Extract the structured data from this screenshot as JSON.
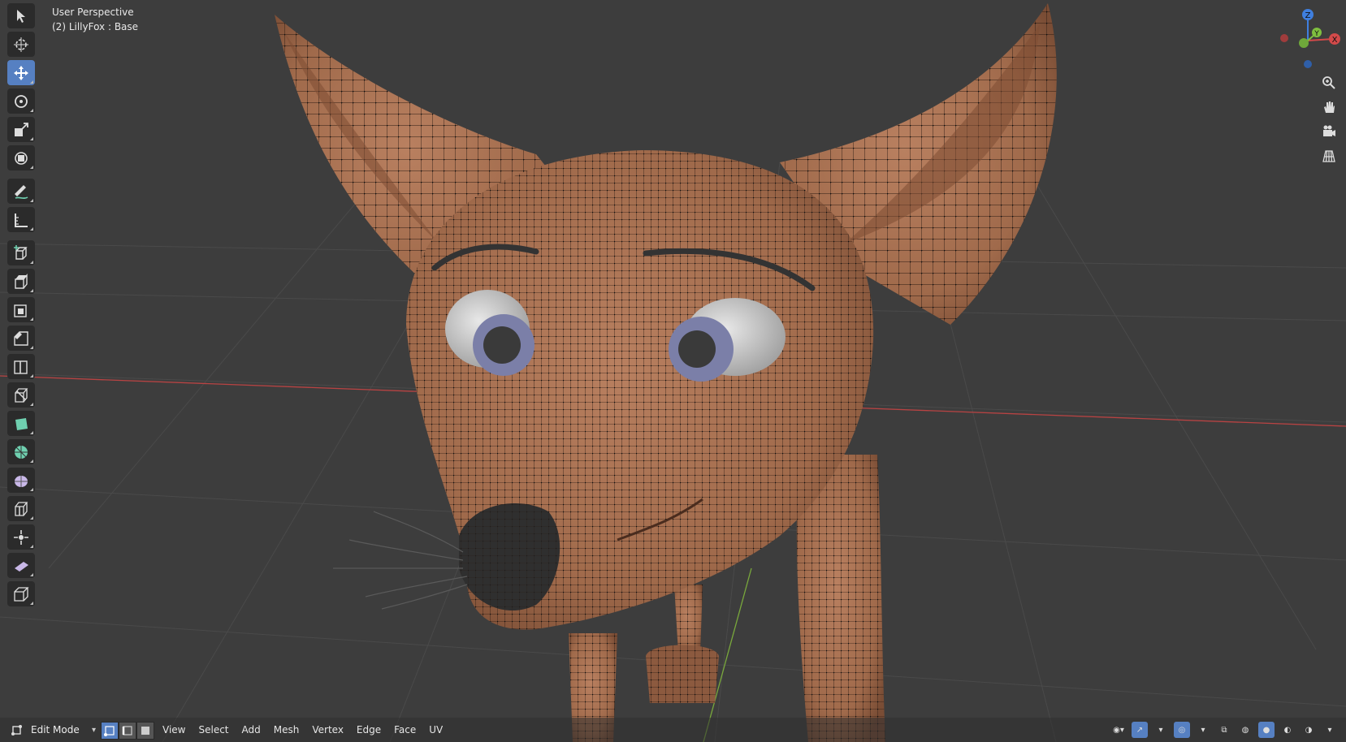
{
  "overlay": {
    "view_name": "User Perspective",
    "object_info": "(2) LillyFox : Base"
  },
  "toolbar": {
    "tools": [
      {
        "name": "select-box-tool-icon",
        "active": false
      },
      {
        "name": "cursor-tool-icon",
        "active": false
      },
      {
        "name": "move-tool-icon",
        "active": true
      },
      {
        "name": "rotate-tool-icon",
        "active": false
      },
      {
        "name": "scale-tool-icon",
        "active": false
      },
      {
        "name": "transform-tool-icon",
        "active": false
      },
      {
        "name": "annotate-tool-icon",
        "active": false
      },
      {
        "name": "measure-tool-icon",
        "active": false
      },
      {
        "name": "add-cube-tool-icon",
        "active": false
      },
      {
        "name": "extrude-region-tool-icon",
        "active": false
      },
      {
        "name": "inset-faces-tool-icon",
        "active": false
      },
      {
        "name": "bevel-tool-icon",
        "active": false
      },
      {
        "name": "loop-cut-tool-icon",
        "active": false
      },
      {
        "name": "knife-tool-icon",
        "active": false
      },
      {
        "name": "poly-build-tool-icon",
        "active": false
      },
      {
        "name": "spin-tool-icon",
        "active": false
      },
      {
        "name": "smooth-tool-icon",
        "active": false
      },
      {
        "name": "edge-slide-tool-icon",
        "active": false
      },
      {
        "name": "shrink-fatten-tool-icon",
        "active": false
      },
      {
        "name": "shear-tool-icon",
        "active": false
      },
      {
        "name": "rip-region-tool-icon",
        "active": false
      }
    ]
  },
  "gizmo": {
    "z": "Z",
    "y": "Y",
    "x": "X"
  },
  "header": {
    "mode": "Edit Mode",
    "menus": [
      "View",
      "Select",
      "Add",
      "Mesh",
      "Vertex",
      "Edge",
      "Face",
      "UV"
    ]
  },
  "colors": {
    "active_tool": "#5680c2",
    "viewport_bg": "#3d3d3d",
    "mesh_skin": "#a8704f",
    "axis_x": "#d24a4a",
    "axis_y": "#7fbf3f",
    "axis_z": "#3f7fdf"
  }
}
